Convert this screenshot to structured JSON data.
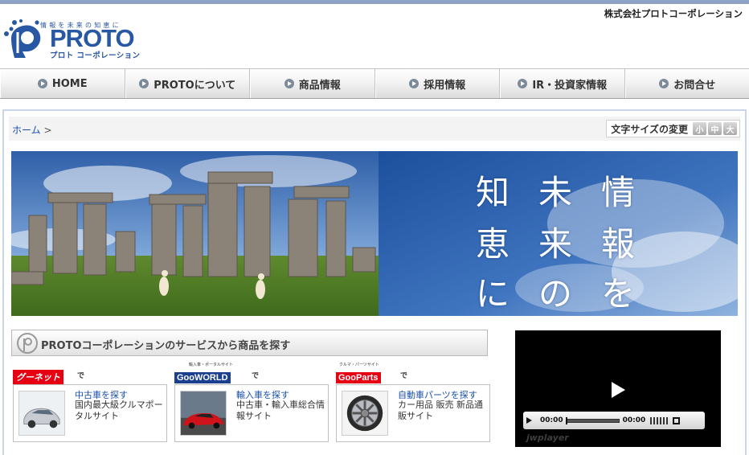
{
  "header": {
    "tagline": "情報を未来の知恵に",
    "logo_name": "PROTO",
    "logo_kana": "プロト コーポレーション",
    "company_name": "株式会社プロトコーポレーション"
  },
  "nav": {
    "items": [
      {
        "label": "HOME"
      },
      {
        "label": "PROTOについて"
      },
      {
        "label": "商品情報"
      },
      {
        "label": "採用情報"
      },
      {
        "label": "IR・投資家情報"
      },
      {
        "label": "お問合せ"
      }
    ]
  },
  "breadcrumb": {
    "home": "ホーム",
    "separator": ">"
  },
  "fontsize": {
    "label": "文字サイズの変更",
    "small": "小",
    "medium": "中",
    "large": "大"
  },
  "hero": {
    "chars": [
      "情",
      "報",
      "を",
      "未",
      "来",
      "の",
      "知",
      "恵",
      "に"
    ]
  },
  "services": {
    "heading": "PROTOコーポレーションのサービスから商品を探す",
    "items": [
      {
        "logo": "グーネット",
        "de": "で",
        "link": "中古車を探す",
        "desc": "国内最大級クルマポータルサイト"
      },
      {
        "logo_small": "輸入車・ポータルサイト",
        "logo": "GooWORLD",
        "de": "で",
        "link": "輸入車を探す",
        "desc": "中古車・輸入車総合情報サイト"
      },
      {
        "logo_small": "クルマ・パーツサイト",
        "logo": "GooParts",
        "de": "で",
        "link": "自動車パーツを探す",
        "desc": "カー用品 販売 新品通販サイト"
      }
    ]
  },
  "player": {
    "current_time": "00:00",
    "duration": "00:00",
    "watermark": "jwplayer"
  }
}
